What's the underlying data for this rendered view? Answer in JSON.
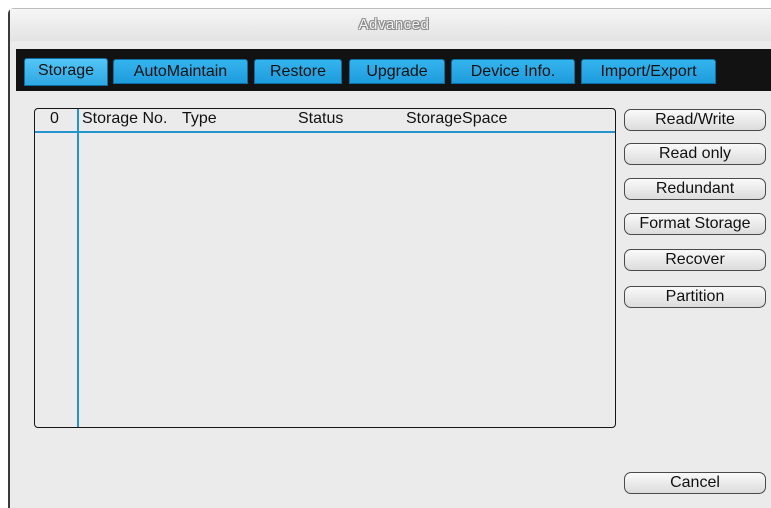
{
  "window": {
    "title": "Advanced"
  },
  "tabs": [
    {
      "label": "Storage",
      "active": true
    },
    {
      "label": "AutoMaintain",
      "active": false
    },
    {
      "label": "Restore",
      "active": false
    },
    {
      "label": "Upgrade",
      "active": false
    },
    {
      "label": "Device Info.",
      "active": false
    },
    {
      "label": "Import/Export",
      "active": false
    }
  ],
  "storage_list": {
    "columns": [
      "0",
      "Storage No.",
      "Type",
      "Status",
      "StorageSpace"
    ],
    "rows": []
  },
  "actions": {
    "read_write": "Read/Write",
    "read_only": "Read only",
    "redundant": "Redundant",
    "format_storage": "Format Storage",
    "recover": "Recover",
    "partition": "Partition",
    "cancel": "Cancel"
  },
  "colors": {
    "tab_blue": "#2fa7e2",
    "tab_strip": "#121212",
    "panel_bg": "#ebebeb",
    "grid_line": "#2593cc"
  }
}
